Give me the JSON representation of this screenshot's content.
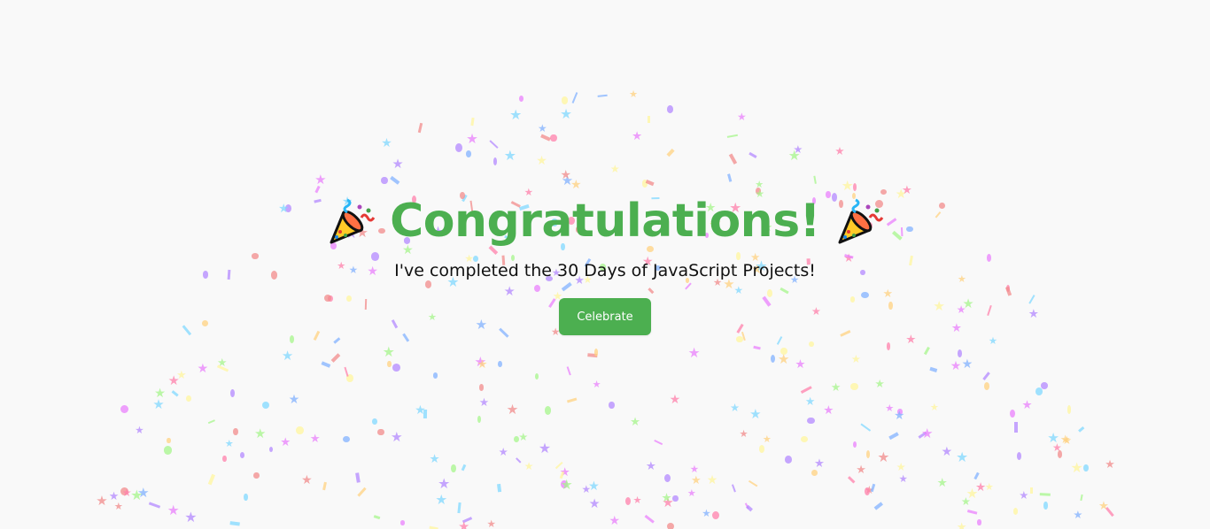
{
  "page": {
    "title": "Congratulations!",
    "subtitle": "I've completed the 30 Days of JavaScript Projects!",
    "button_label": "Celebrate",
    "accent_color": "#4caf50",
    "background_color": "#f9f9f9"
  },
  "icons": {
    "left": "party-popper-icon",
    "right": "party-popper-icon"
  },
  "confetti": {
    "colors": [
      "#f28b8b",
      "#b388ff",
      "#80d8ff",
      "#a5f58b",
      "#ffd180",
      "#ff80ab",
      "#fff59d",
      "#ea80fc",
      "#82b1ff"
    ]
  }
}
